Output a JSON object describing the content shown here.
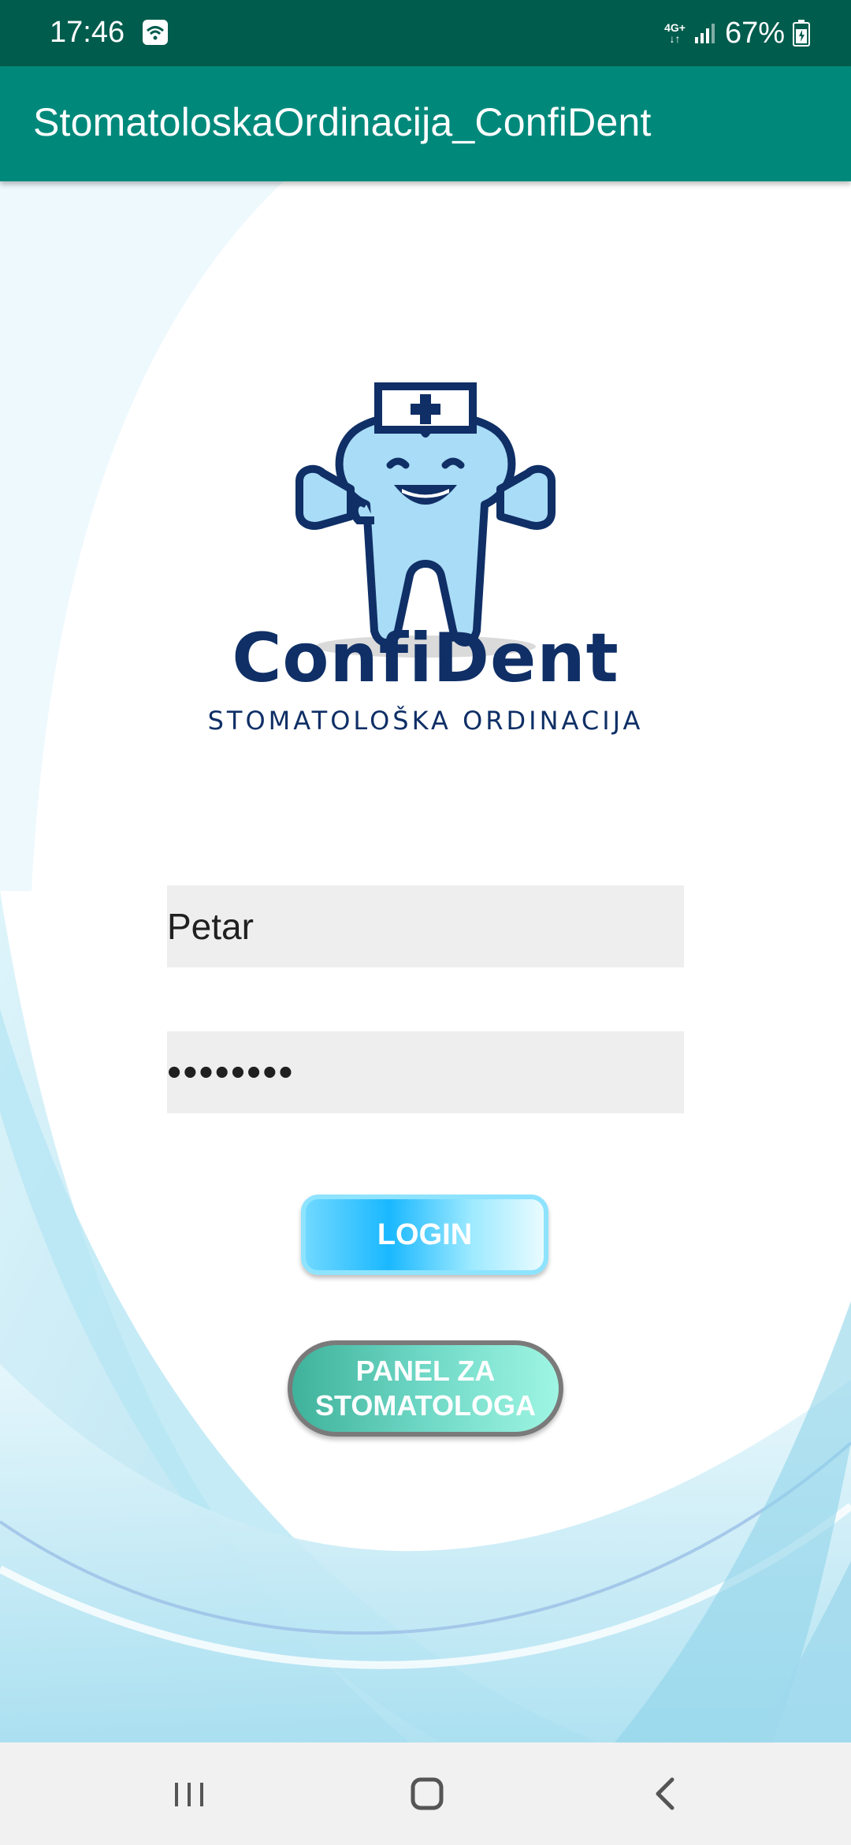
{
  "status_bar": {
    "time": "17:46",
    "network_top": "4G+",
    "network_arrows": "↓↑",
    "battery_percent": "67%"
  },
  "app_bar": {
    "title": "StomatoloskaOrdinacija_ConfiDent"
  },
  "brand": {
    "name": "ConfiDent",
    "subtitle": "STOMATOLOŠKA ORDINACIJA"
  },
  "login_form": {
    "username_value": "Petar",
    "password_value": "••••••••",
    "login_label": "LOGIN",
    "panel_label_line1": "PANEL ZA",
    "panel_label_line2": "STOMATOLOGA"
  },
  "colors": {
    "status_bar": "#005c4d",
    "app_bar": "#00897b",
    "brand_text": "#0f2f66",
    "login_button": "#1ab8ff",
    "panel_button": "#6fd8c6"
  },
  "icons": {
    "status_wifi": "wifi-icon",
    "status_signal": "signal-icon",
    "status_battery": "battery-icon",
    "logo": "tooth-mascot-icon",
    "nav_recents": "recents-icon",
    "nav_home": "home-icon",
    "nav_back": "back-icon"
  }
}
